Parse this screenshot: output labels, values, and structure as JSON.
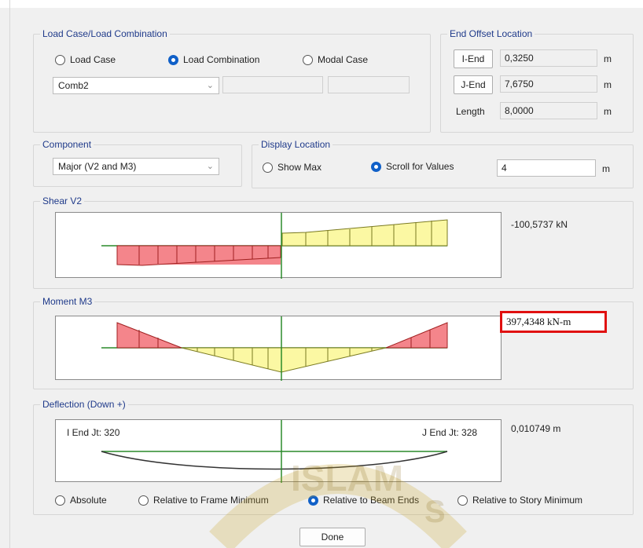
{
  "load_case_group": {
    "legend": "Load Case/Load Combination",
    "options": [
      {
        "label": "Load Case",
        "selected": false
      },
      {
        "label": "Load Combination",
        "selected": true
      },
      {
        "label": "Modal Case",
        "selected": false
      }
    ],
    "combo_value": "Comb2",
    "combo_icon": "chevron-down-icon",
    "extra_field_1": "",
    "extra_field_2": ""
  },
  "end_offset_group": {
    "legend": "End Offset Location",
    "i_end_label": "I-End",
    "i_end_value": "0,3250",
    "j_end_label": "J-End",
    "j_end_value": "7,6750",
    "length_label": "Length",
    "length_value": "8,0000",
    "unit": "m"
  },
  "component_group": {
    "legend": "Component",
    "value": "Major (V2 and M3)"
  },
  "display_location_group": {
    "legend": "Display Location",
    "options": [
      {
        "label": "Show Max",
        "selected": false
      },
      {
        "label": "Scroll for Values",
        "selected": true
      }
    ],
    "scroll_value": "4",
    "unit": "m"
  },
  "shear_group": {
    "legend": "Shear V2",
    "readout": "-100,5737 kN"
  },
  "moment_group": {
    "legend": "Moment M3",
    "readout": "397,4348 kN-m"
  },
  "deflection_group": {
    "legend": "Deflection (Down +)",
    "i_end_text": "I End Jt: 320",
    "j_end_text": "J End Jt: 328",
    "readout": "0,010749 m",
    "options": [
      {
        "label": "Absolute",
        "selected": false
      },
      {
        "label": "Relative to Frame Minimum",
        "selected": false
      },
      {
        "label": "Relative to Beam Ends",
        "selected": true
      },
      {
        "label": "Relative to Story Minimum",
        "selected": false
      }
    ]
  },
  "done_label": "Done",
  "colors": {
    "negative_fill": "#f4858b",
    "positive_fill": "#fbf8a3",
    "baseline": "#2a8a2a",
    "cursor": "#2a8a2a",
    "deflection_curve": "#333333",
    "radio_selected": "#1060c8",
    "legend_text": "#1f3a8a",
    "highlight_border": "#e01010"
  },
  "watermark": {
    "text": "ISLAM",
    "text_extra": "S"
  }
}
